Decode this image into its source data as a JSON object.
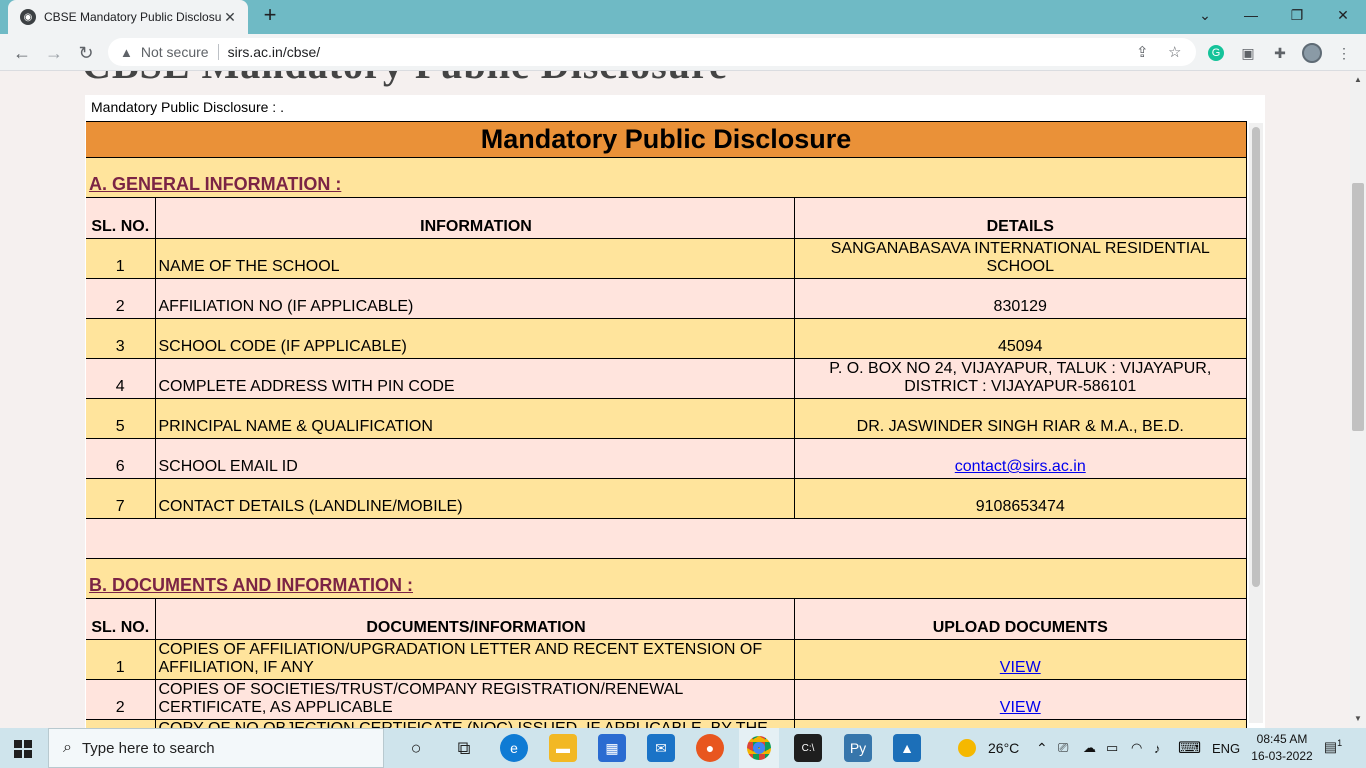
{
  "browser": {
    "tab_title": "CBSE Mandatory Public Disclosur",
    "tab_close": "✕",
    "new_tab": "+",
    "security_label": "Not secure",
    "url": "sirs.ac.in/cbse/"
  },
  "page": {
    "ghost_title": "CBSE Mandatory Public Disclosure",
    "frame_label": "Mandatory Public Disclosure : .",
    "table_title": "Mandatory Public Disclosure",
    "section_a": {
      "title": "A. GENERAL INFORMATION :",
      "headers": [
        "SL. NO.",
        "INFORMATION",
        "DETAILS"
      ],
      "rows": [
        {
          "sl": "1",
          "info": "NAME OF THE SCHOOL",
          "details": "SANGANABASAVA INTERNATIONAL RESIDENTIAL SCHOOL"
        },
        {
          "sl": "2",
          "info": "AFFILIATION NO (IF APPLICABLE)",
          "details": "830129"
        },
        {
          "sl": "3",
          "info": "SCHOOL CODE (IF APPLICABLE)",
          "details": "45094"
        },
        {
          "sl": "4",
          "info": "COMPLETE ADDRESS WITH PIN CODE",
          "details": "P. O. BOX NO 24, VIJAYAPUR, TALUK : VIJAYAPUR, DISTRICT : VIJAYAPUR-586101"
        },
        {
          "sl": "5",
          "info": "PRINCIPAL NAME & QUALIFICATION",
          "details": "DR. JASWINDER SINGH RIAR & M.A., BE.D."
        },
        {
          "sl": "6",
          "info": "SCHOOL EMAIL ID",
          "details": "contact@sirs.ac.in"
        },
        {
          "sl": "7",
          "info": "CONTACT DETAILS (LANDLINE/MOBILE)",
          "details": "9108653474"
        }
      ]
    },
    "section_b": {
      "title": "B. DOCUMENTS AND INFORMATION :",
      "headers": [
        "SL. NO.",
        "DOCUMENTS/INFORMATION",
        "UPLOAD DOCUMENTS"
      ],
      "rows": [
        {
          "sl": "1",
          "doc": "COPIES OF AFFILIATION/UPGRADATION LETTER AND RECENT EXTENSION OF AFFILIATION, IF ANY",
          "link": "VIEW"
        },
        {
          "sl": "2",
          "doc": "COPIES OF SOCIETIES/TRUST/COMPANY REGISTRATION/RENEWAL CERTIFICATE, AS APPLICABLE",
          "link": "VIEW"
        },
        {
          "sl": "3",
          "doc": "COPY OF NO OBJECTION CERTIFICATE (NOC) ISSUED, IF APPLICABLE, BY THE",
          "link": ""
        }
      ]
    }
  },
  "taskbar": {
    "search_placeholder": "Type here to search",
    "weather": "26°C",
    "language": "ENG",
    "time": "08:45 AM",
    "date": "16-03-2022",
    "notification_count": "1"
  }
}
